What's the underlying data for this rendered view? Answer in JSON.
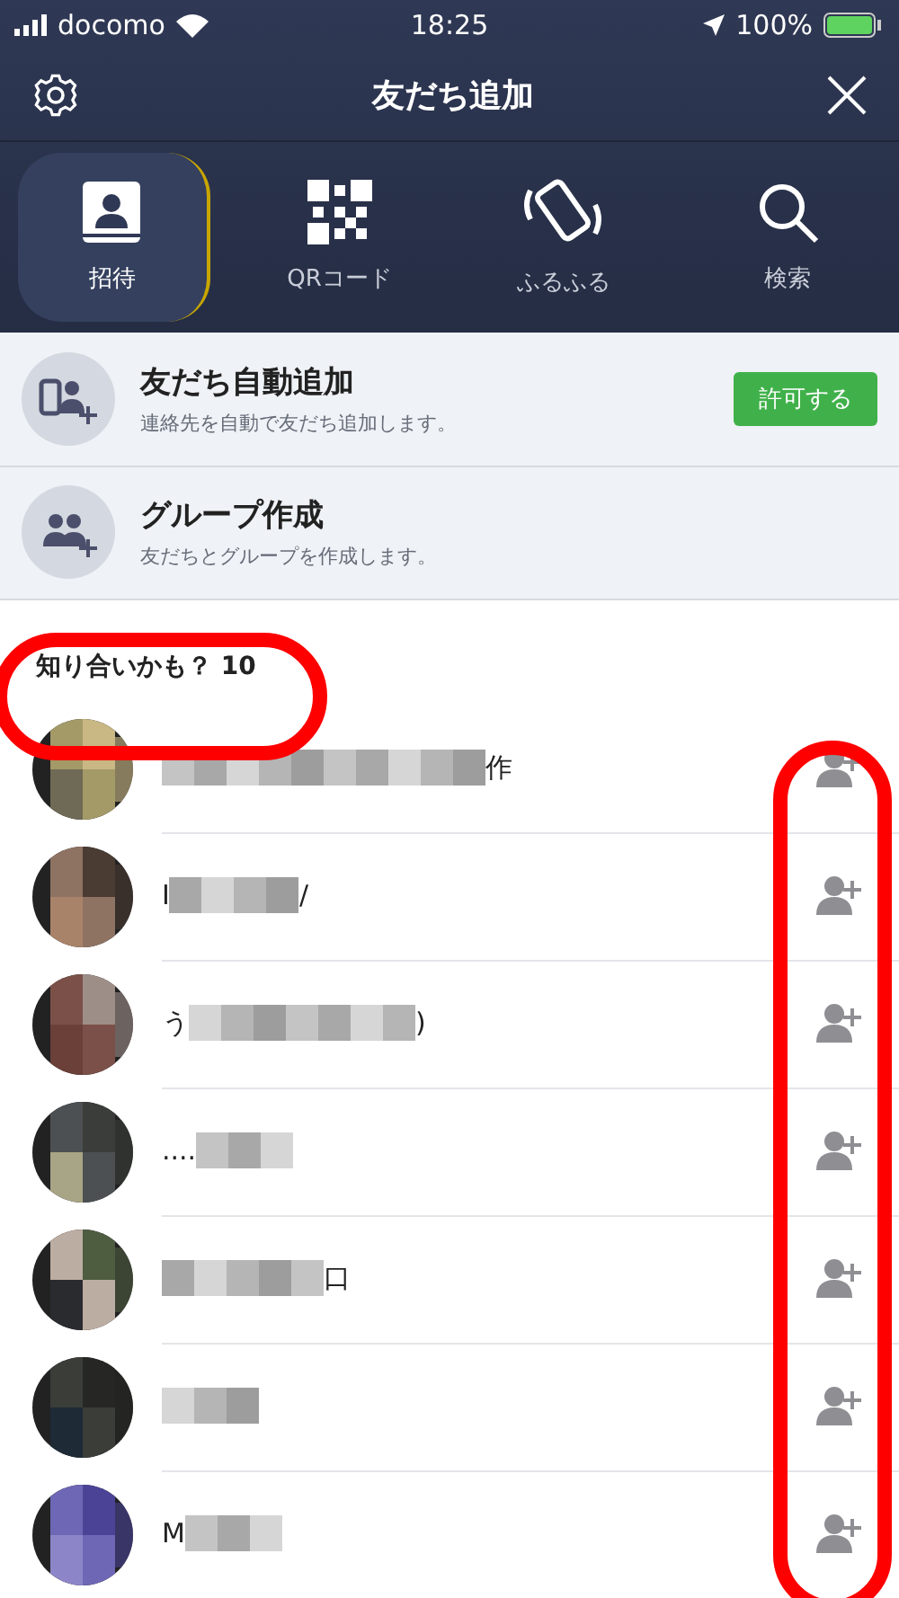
{
  "status_bar": {
    "carrier": "docomo",
    "time": "18:25",
    "battery": "100%"
  },
  "header": {
    "title": "友だち追加"
  },
  "tabs": [
    {
      "label": "招待",
      "kind": "contacts",
      "selected": true
    },
    {
      "label": "QRコード",
      "kind": "qr",
      "selected": false
    },
    {
      "label": "ふるふる",
      "kind": "shake",
      "selected": false
    },
    {
      "label": "検索",
      "kind": "search",
      "selected": false
    }
  ],
  "actions": [
    {
      "kind": "auto",
      "title": "友だち自動追加",
      "subtitle": "連絡先を自動で友だち追加します。",
      "button": "許可する"
    },
    {
      "kind": "group",
      "title": "グループ作成",
      "subtitle": "友だちとグループを作成します。"
    }
  ],
  "suggestions": {
    "title": "知り合いかも？ 10",
    "contacts": [
      {
        "kind": "contact",
        "name_end": "作"
      },
      {
        "kind": "contact",
        "name_start": "I",
        "name_end": "/"
      },
      {
        "kind": "contact",
        "name_start": "う",
        "name_end": ")"
      },
      {
        "kind": "contact",
        "name_start": "...."
      },
      {
        "kind": "contact",
        "name_end": "口"
      },
      {
        "kind": "contact"
      },
      {
        "kind": "contact",
        "name_start": "M"
      }
    ]
  }
}
